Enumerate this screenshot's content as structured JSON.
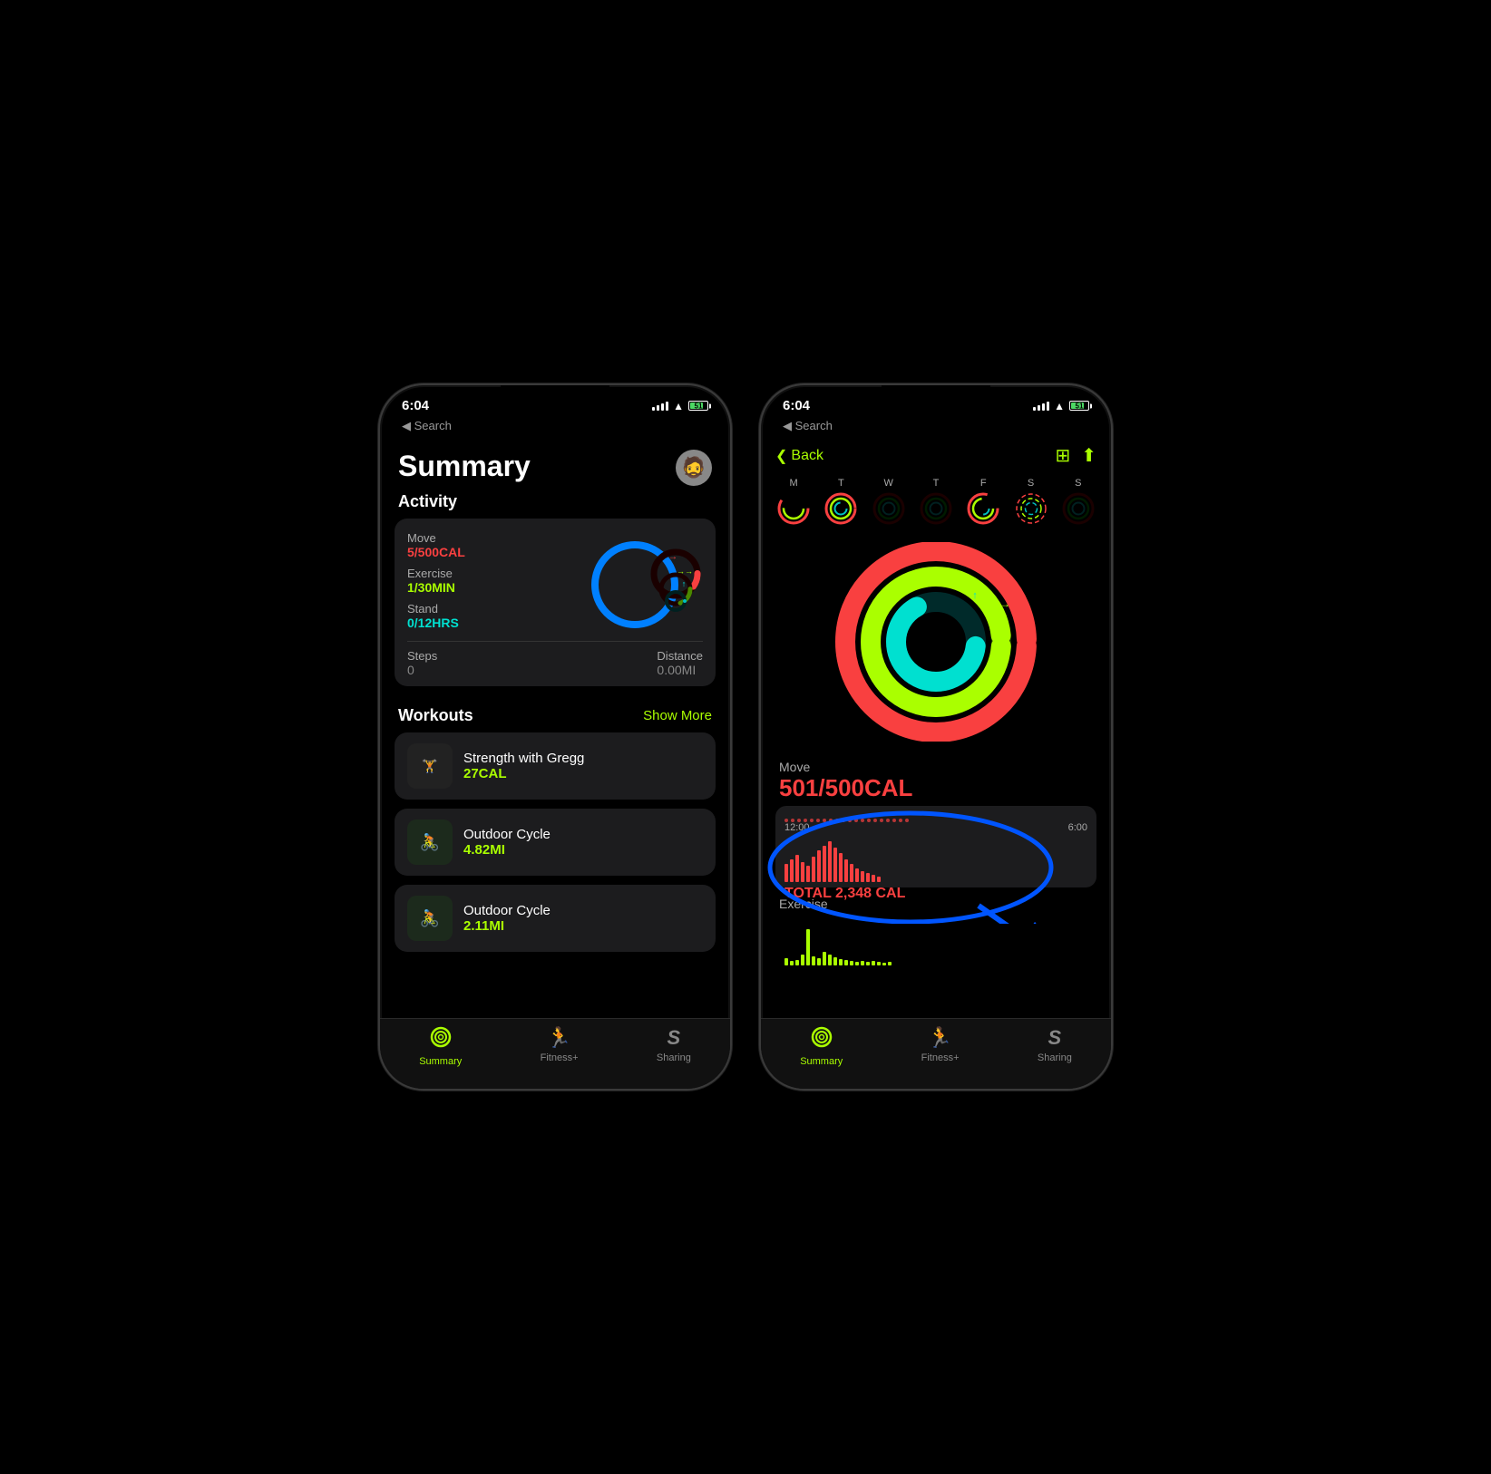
{
  "phone1": {
    "statusBar": {
      "time": "6:04",
      "back": "◀ Search",
      "batteryLevel": "51"
    },
    "header": {
      "title": "Summary",
      "avatarEmoji": "🧔"
    },
    "activity": {
      "sectionLabel": "Activity",
      "move": {
        "label": "Move",
        "value": "5/500CAL"
      },
      "exercise": {
        "label": "Exercise",
        "value": "1/30MIN"
      },
      "stand": {
        "label": "Stand",
        "value": "0/12HRS"
      },
      "steps": {
        "label": "Steps",
        "value": "0"
      },
      "distance": {
        "label": "Distance",
        "value": "0.00MI"
      }
    },
    "workouts": {
      "sectionLabel": "Workouts",
      "showMore": "Show More",
      "items": [
        {
          "name": "Strength with Gregg",
          "value": "27CAL",
          "icon": "🏋️",
          "valueColor": "green"
        },
        {
          "name": "Outdoor Cycle",
          "value": "4.82MI",
          "icon": "🚴",
          "valueColor": "green"
        },
        {
          "name": "Outdoor Cycle",
          "value": "2.11MI",
          "icon": "🚴",
          "valueColor": "green"
        }
      ]
    },
    "tabBar": {
      "tabs": [
        {
          "label": "Summary",
          "icon": "🎯",
          "active": true
        },
        {
          "label": "Fitness+",
          "icon": "🏃",
          "active": false
        },
        {
          "label": "Sharing",
          "icon": "S",
          "active": false
        }
      ]
    }
  },
  "phone2": {
    "statusBar": {
      "time": "6:04",
      "back": "◀ Search",
      "batteryLevel": "51"
    },
    "nav": {
      "backLabel": "Back",
      "calendarIcon": "📅",
      "shareIcon": "⬆️"
    },
    "week": {
      "days": [
        "M",
        "T",
        "W",
        "T",
        "F",
        "S",
        "S"
      ]
    },
    "move": {
      "label": "Move",
      "value": "501/500CAL"
    },
    "chart": {
      "times": [
        "12:00",
        "6:00"
      ],
      "totalLabel": "TOTAL 2,348 CAL"
    },
    "exercise": {
      "label": "Exercise"
    },
    "tabBar": {
      "tabs": [
        {
          "label": "Summary",
          "icon": "🎯",
          "active": true
        },
        {
          "label": "Fitness+",
          "icon": "🏃",
          "active": false
        },
        {
          "label": "Sharing",
          "icon": "S",
          "active": false
        }
      ]
    }
  }
}
